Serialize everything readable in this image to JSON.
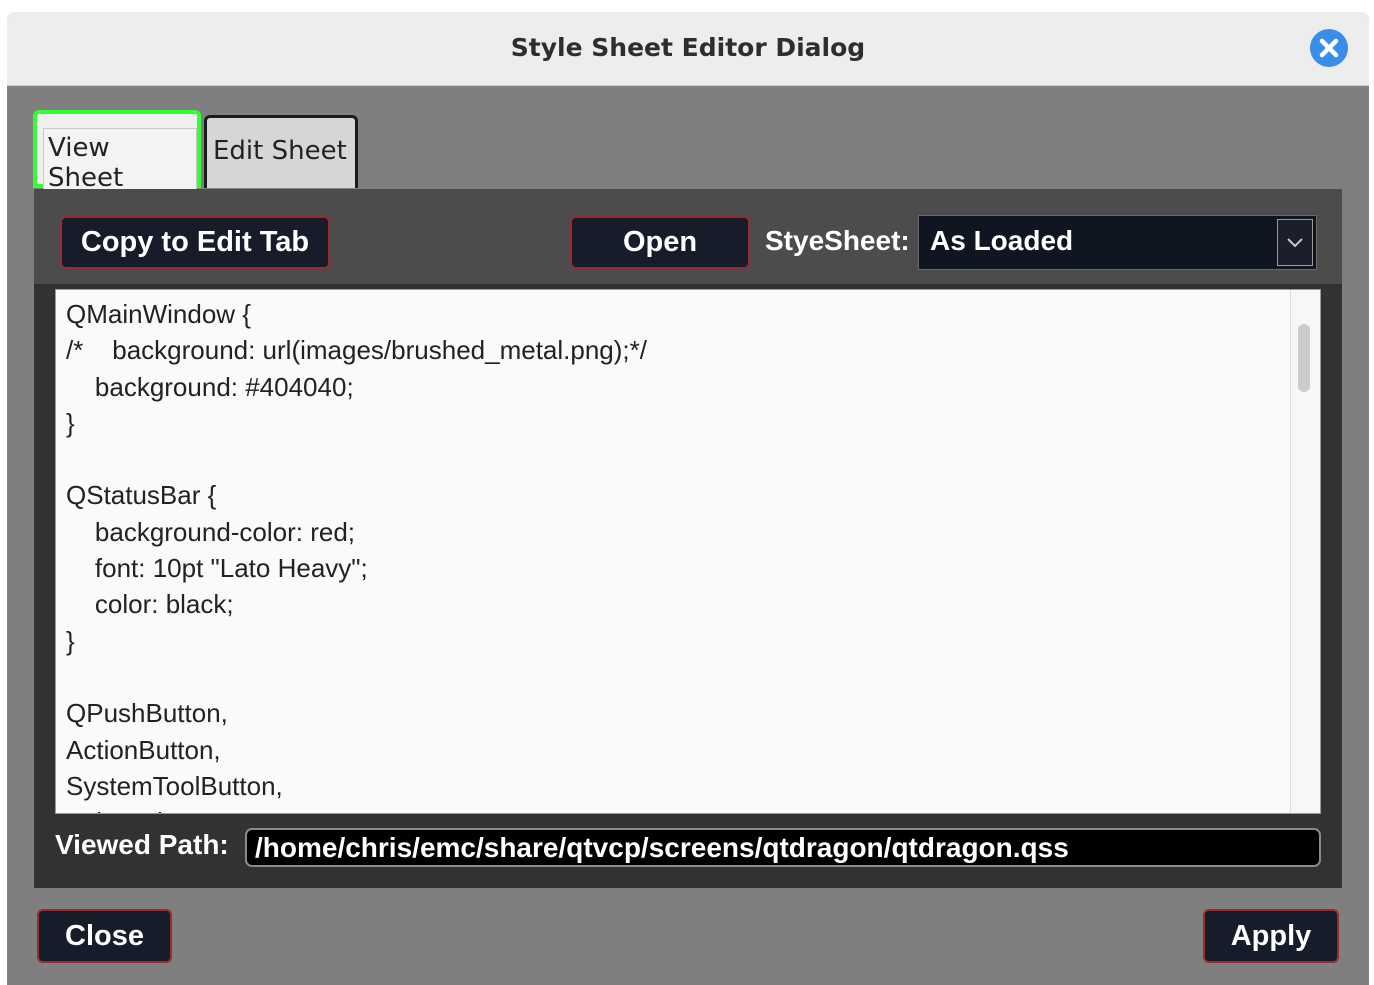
{
  "window": {
    "title": "Style Sheet Editor Dialog",
    "close_icon": "close-icon",
    "accent": "#3a8de8"
  },
  "tabs": [
    {
      "label": "View Sheet",
      "active": true,
      "focus_color": "#33ff33"
    },
    {
      "label": "Edit Sheet",
      "active": false
    }
  ],
  "toolbar": {
    "copy_label": "Copy to Edit Tab",
    "open_label": "Open",
    "stylesheet_label": "StyeSheet:",
    "stylesheet_value": "As Loaded"
  },
  "editor": {
    "content": "QMainWindow {\n/*    background: url(images/brushed_metal.png);*/\n    background: #404040;\n}\n\nQStatusBar {\n    background-color: red;\n    font: 10pt \"Lato Heavy\";\n    color: black;\n}\n\nQPushButton,\nActionButton,\nSystemToolButton,\nAxisToolButton,"
  },
  "path": {
    "label": "Viewed Path:",
    "value": "/home/chris/emc/share/qtvcp/screens/qtdragon/qtdragon.qss"
  },
  "footer": {
    "close_label": "Close",
    "apply_label": "Apply"
  },
  "colors": {
    "button_bg": "#161c29",
    "button_border": "#9a2a2f",
    "dialog_bg": "#7f7f7f"
  }
}
